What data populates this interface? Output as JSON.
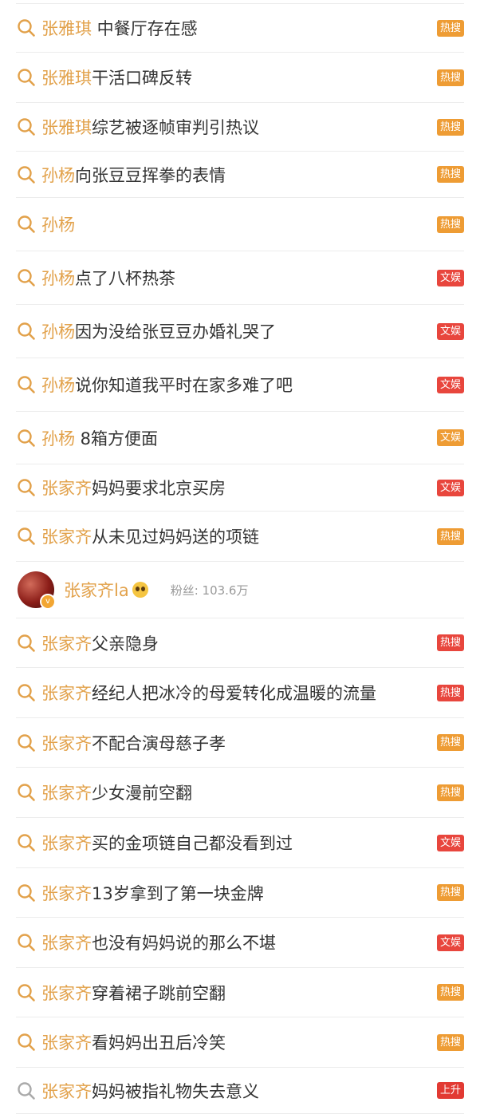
{
  "colors": {
    "keyword": "#e2a14a",
    "hot": "#ee9c34",
    "ent": "#e8463d",
    "rise": "#e23a33",
    "divider": "#ececec"
  },
  "items": [
    {
      "keyword": "张雅琪",
      "rest": " 中餐厅存在感",
      "badge": "热搜",
      "type": "hot"
    },
    {
      "keyword": "张雅琪",
      "rest": "干活口碑反转",
      "badge": "热搜",
      "type": "hot"
    },
    {
      "keyword": "张雅琪",
      "rest": "综艺被逐帧审判引热议",
      "badge": "热搜",
      "type": "hot"
    },
    {
      "keyword": "孙杨",
      "rest": "向张豆豆挥拳的表情",
      "badge": "热搜",
      "type": "hot"
    },
    {
      "keyword": "孙杨",
      "rest": "",
      "badge": "热搜",
      "type": "hot"
    },
    {
      "keyword": "孙杨",
      "rest": "点了八杯热茶",
      "badge": "文娱",
      "type": "ent"
    },
    {
      "keyword": "孙杨",
      "rest": "因为没给张豆豆办婚礼哭了",
      "badge": "文娱",
      "type": "ent"
    },
    {
      "keyword": "孙杨",
      "rest": "说你知道我平时在家多难了吧",
      "badge": "文娱",
      "type": "ent"
    },
    {
      "keyword": "孙杨",
      "rest": " 8箱方便面",
      "badge": "文娱",
      "type": "hot"
    },
    {
      "keyword": "张家齐",
      "rest": "妈妈要求北京买房",
      "badge": "文娱",
      "type": "ent"
    },
    {
      "keyword": "张家齐",
      "rest": "从未见过妈妈送的项链",
      "badge": "热搜",
      "type": "hot"
    },
    {
      "user": true,
      "name": "张家齐la",
      "fans_label": "粉丝: 103.6万",
      "icon": "smiley-emoji-icon"
    },
    {
      "keyword": "张家齐",
      "rest": "父亲隐身",
      "badge": "热搜",
      "type": "ent"
    },
    {
      "keyword": "张家齐",
      "rest": "经纪人把冰冷的母爱转化成温暖的流量",
      "badge": "热搜",
      "type": "ent"
    },
    {
      "keyword": "张家齐",
      "rest": "不配合演母慈子孝",
      "badge": "热搜",
      "type": "hot"
    },
    {
      "keyword": "张家齐",
      "rest": "少女漫前空翻",
      "badge": "热搜",
      "type": "hot"
    },
    {
      "keyword": "张家齐",
      "rest": "买的金项链自己都没看到过",
      "badge": "文娱",
      "type": "ent"
    },
    {
      "keyword": "张家齐",
      "rest": "13岁拿到了第一块金牌",
      "badge": "热搜",
      "type": "hot"
    },
    {
      "keyword": "张家齐",
      "rest": "也没有妈妈说的那么不堪",
      "badge": "文娱",
      "type": "ent"
    },
    {
      "keyword": "张家齐",
      "rest": "穿着裙子跳前空翻",
      "badge": "热搜",
      "type": "hot"
    },
    {
      "keyword": "张家齐",
      "rest": "看妈妈出丑后冷笑",
      "badge": "热搜",
      "type": "hot"
    },
    {
      "keyword": "张家齐",
      "rest": "妈妈被指礼物失去意义",
      "badge": "上升",
      "type": "rise"
    }
  ]
}
